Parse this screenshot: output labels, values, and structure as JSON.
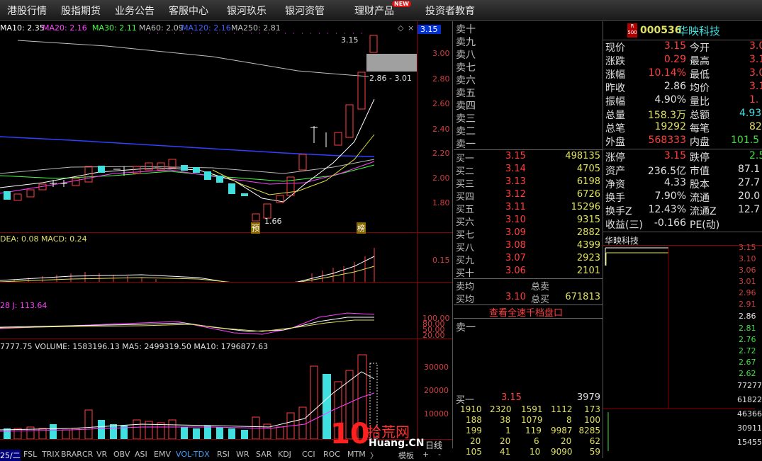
{
  "nav": {
    "items": [
      "港股行情",
      "股指期货",
      "业务公告",
      "客服中心",
      "银河玖乐",
      "银河资管",
      "理财产品",
      "投资者教育"
    ],
    "new_badge": "NEW"
  },
  "main_chart": {
    "ma_legend": [
      {
        "label": "MA10: 2.35",
        "color": "#ffffff"
      },
      {
        "label": "MA20: 2.16",
        "color": "#ff40ff"
      },
      {
        "label": "MA30: 2.11",
        "color": "#40ff40"
      },
      {
        "label": "MA60: 2.09",
        "color": "#c0c0c0"
      },
      {
        "label": "MA120: 2.16",
        "color": "#4040ff"
      },
      {
        "label": "MA250: 2.81",
        "color": "#c0c0c0"
      }
    ],
    "price_ticks": [
      "3.00",
      "2.80",
      "2.60",
      "2.40",
      "2.20",
      "2.00",
      "1.80"
    ],
    "current_price_tag": "3.15",
    "high_annotation": "3.15",
    "low_annotation": "1.66",
    "range_annotation": "2.86 - 3.01",
    "marker_yu": "预",
    "marker_bang": "榜"
  },
  "macd": {
    "legend": "DEA: 0.08  MACD: 0.24",
    "tick": "0.15"
  },
  "kdj": {
    "legend": "28  J: 113.64",
    "ticks": [
      "100.00",
      "80.00",
      "50.00",
      "20.00"
    ]
  },
  "volume": {
    "legend": "7777.75  VOLUME: 1583196.13  MA5: 2499319.50  MA10: 1796877.63",
    "ticks": [
      "30000",
      "20000",
      "10000"
    ]
  },
  "bottom_tabs": [
    "25/二",
    "FSL",
    "TRIX",
    "BRAR",
    "CR",
    "VR",
    "OBV",
    "ASI",
    "EMV",
    "VOL-TDX",
    "RSI",
    "WR",
    "SAR",
    "KDJ",
    "CCI",
    "ROC",
    "MTM",
    "〉",
    "模板",
    "+",
    "-",
    "日线"
  ],
  "order_book": {
    "sells": [
      "卖十",
      "卖九",
      "卖八",
      "卖七",
      "卖六",
      "卖五",
      "卖四",
      "卖三",
      "卖二",
      "卖一"
    ],
    "buys": [
      {
        "label": "买一",
        "price": "3.15",
        "vol": "498135"
      },
      {
        "label": "买二",
        "price": "3.14",
        "vol": "4705"
      },
      {
        "label": "买三",
        "price": "3.13",
        "vol": "6198"
      },
      {
        "label": "买四",
        "price": "3.12",
        "vol": "6726"
      },
      {
        "label": "买五",
        "price": "3.11",
        "vol": "15296"
      },
      {
        "label": "买六",
        "price": "3.10",
        "vol": "9315"
      },
      {
        "label": "买七",
        "price": "3.09",
        "vol": "2882"
      },
      {
        "label": "买八",
        "price": "3.08",
        "vol": "4399"
      },
      {
        "label": "买九",
        "price": "3.07",
        "vol": "2923"
      },
      {
        "label": "买十",
        "price": "3.06",
        "vol": "2101"
      }
    ],
    "sell_avg_label": "卖均",
    "total_sell_label": "总卖",
    "buy_avg_label": "买均",
    "buy_avg": "3.10",
    "total_buy_label": "总买",
    "total_buy": "671813",
    "fast_link": "查看全速千档盘口",
    "sell1_label": "卖一",
    "buy1_label": "买一",
    "buy1_price": "3.15",
    "buy1_vol": "3979",
    "queue": [
      [
        "1910",
        "2320",
        "1591",
        "1112",
        "173"
      ],
      [
        "188",
        "38",
        "1079",
        "8",
        "100"
      ],
      [
        "199",
        "1",
        "119",
        "9987",
        "8285"
      ],
      [
        "20",
        "20",
        "6",
        "20",
        "62"
      ],
      [
        "105",
        "41",
        "10",
        "9090",
        "59"
      ]
    ]
  },
  "stock": {
    "flag_top": "R",
    "flag_bottom": "500",
    "code": "000536",
    "name": "华映科技",
    "rows": [
      {
        "l1": "现价",
        "v1": "3.15",
        "c1": "red",
        "l2": "今开",
        "v2": "3.0",
        "c2": "red"
      },
      {
        "l1": "涨跌",
        "v1": "0.29",
        "c1": "red",
        "l2": "最高",
        "v2": "3.1",
        "c2": "red"
      },
      {
        "l1": "涨幅",
        "v1": "10.14%",
        "c1": "red",
        "l2": "最低",
        "v2": "3.0",
        "c2": "red"
      },
      {
        "l1": "昨收",
        "v1": "2.86",
        "c1": "white",
        "l2": "均价",
        "v2": "3.1",
        "c2": "red"
      },
      {
        "l1": "振幅",
        "v1": "4.90%",
        "c1": "white",
        "l2": "量比",
        "v2": "1.",
        "c2": "red"
      },
      {
        "l1": "总量",
        "v1": "158.3万",
        "c1": "yellow",
        "l2": "总额",
        "v2": "4.93",
        "c2": "cyan"
      },
      {
        "l1": "总笔",
        "v1": "19292",
        "c1": "yellow",
        "l2": "每笔",
        "v2": "82",
        "c2": "yellow"
      },
      {
        "l1": "外盘",
        "v1": "568333",
        "c1": "red",
        "l2": "内盘",
        "v2": "101.5",
        "c2": "green"
      }
    ],
    "rows2": [
      {
        "l1": "涨停",
        "v1": "3.15",
        "c1": "red",
        "l2": "跌停",
        "v2": "2.5",
        "c2": "green"
      },
      {
        "l1": "资产",
        "v1": "236.5亿",
        "c1": "white",
        "l2": "市值",
        "v2": "87.1",
        "c2": "white"
      },
      {
        "l1": "净资",
        "v1": "4.33",
        "c1": "white",
        "l2": "股本",
        "v2": "27.7",
        "c2": "white"
      },
      {
        "l1": "换手",
        "v1": "7.90%",
        "c1": "white",
        "l2": "流通",
        "v2": "20.0",
        "c2": "white"
      },
      {
        "l1": "换手Z",
        "v1": "12.43%",
        "c1": "white",
        "l2": "流通Z",
        "v2": "12.7",
        "c2": "white"
      },
      {
        "l1": "收益(三)",
        "v1": "-0.166",
        "c1": "white",
        "l2": "PE(动)",
        "v2": "",
        "c2": "white"
      }
    ]
  },
  "mini_chart": {
    "title": "华映科技",
    "price_ticks": [
      "3.15",
      "3.10",
      "3.06",
      "3.01",
      "2.96",
      "2.91",
      "2.86",
      "2.81",
      "2.76",
      "2.72",
      "2.67",
      "2.62"
    ],
    "vol_ticks": [
      "77277",
      "61822",
      "46366",
      "30911",
      "15455"
    ]
  },
  "watermark": {
    "big": "10",
    "text1": "拾荒网",
    "text2": "Huang.CN"
  }
}
